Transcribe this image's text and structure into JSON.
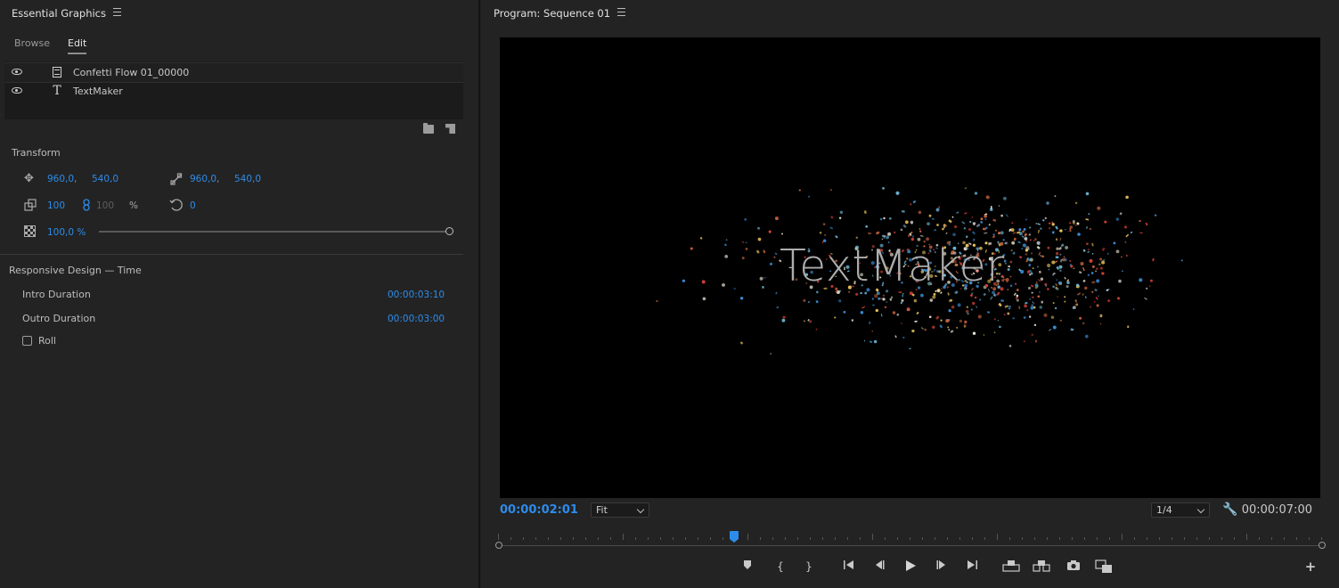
{
  "left_panel": {
    "title": "Essential Graphics",
    "tabs": [
      {
        "label": "Browse",
        "active": false
      },
      {
        "label": "Edit",
        "active": true
      }
    ],
    "layers": [
      {
        "name": "Confetti Flow 01_00000",
        "type": "film-icon",
        "visible": true
      },
      {
        "name": "TextMaker",
        "type": "text-icon",
        "visible": true
      }
    ],
    "layer_text_glyph": "T",
    "transform": {
      "label": "Transform",
      "position_x": "960,0",
      "position_sep": ",",
      "position_y": "540,0",
      "anchor_x": "960,0",
      "anchor_sep": ",",
      "anchor_y": "540,0",
      "scale": "100",
      "scale_linked": "100",
      "scale_unit": "%",
      "rotation": "0",
      "opacity": "100,0 %",
      "opacity_fraction": 1.0
    },
    "responsive": {
      "label": "Responsive Design — Time",
      "intro_label": "Intro Duration",
      "intro_value": "00:00:03:10",
      "outro_label": "Outro Duration",
      "outro_value": "00:00:03:00",
      "roll_label": "Roll",
      "roll_checked": false
    }
  },
  "program_monitor": {
    "title": "Program: Sequence 01",
    "overlay_text": "TextMaker",
    "current_time": "00:00:02:01",
    "zoom": "Fit",
    "resolution": "1/4",
    "duration": "00:00:07:00",
    "playhead_fraction": 0.286
  },
  "colors": {
    "accent": "#2d8ceb",
    "panel_bg": "#232323",
    "confetti": [
      "#d8433a",
      "#3b8ed6",
      "#e9c35a",
      "#e8e2d2",
      "#c9653f",
      "#6db7d6"
    ]
  },
  "icons": {
    "transport": [
      "marker-icon",
      "mark-in-icon",
      "mark-out-icon",
      "go-to-in-icon",
      "step-back-icon",
      "play-icon",
      "step-forward-icon",
      "go-to-out-icon",
      "lift-icon",
      "extract-icon",
      "export-frame-icon",
      "comparison-view-icon",
      "add-button-icon"
    ]
  }
}
